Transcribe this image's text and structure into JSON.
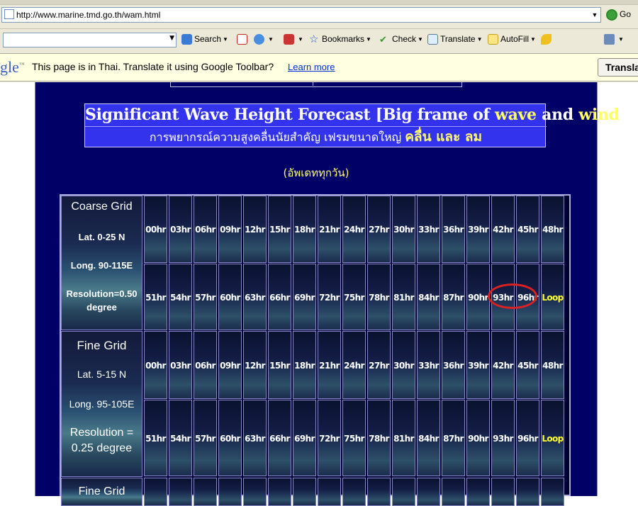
{
  "browser": {
    "url": "http://www.marine.tmd.go.th/wam.html",
    "go_label": "Go",
    "toolbar": {
      "search_label": "Search",
      "bookmarks_label": "Bookmarks",
      "check_label": "Check",
      "translate_label": "Translate",
      "autofill_label": "AutoFill"
    },
    "translate_bar": {
      "logo": "gle",
      "message": "This page is in Thai.  Translate it using Google Toolbar?",
      "link": "Learn more",
      "button": "Transla"
    }
  },
  "page": {
    "title_parts": [
      "Significant Wave Height Forecast [Big frame of ",
      "wave",
      " and ",
      "wind",
      "]"
    ],
    "subtitle_parts": [
      "การพยากรณ์ความสูงคลื่นนัยสำคัญ เฟรมขนาดใหญ่ ",
      "คลื่น และ ลม"
    ],
    "update_note": "(อัพเดททุกวัน)",
    "grids": [
      {
        "name": "Coarse Grid",
        "lat": "Lat. 0-25 N",
        "long": "Long. 90-115E",
        "resolution_lines": [
          "Resolution=0.50",
          "degree"
        ],
        "row1": [
          "00hr",
          "03hr",
          "06hr",
          "09hr",
          "12hr",
          "15hr",
          "18hr",
          "21hr",
          "24hr",
          "27hr",
          "30hr",
          "33hr",
          "36hr",
          "39hr",
          "42hr",
          "45hr",
          "48hr"
        ],
        "row2": [
          "51hr",
          "54hr",
          "57hr",
          "60hr",
          "63hr",
          "66hr",
          "69hr",
          "72hr",
          "75hr",
          "78hr",
          "81hr",
          "84hr",
          "87hr",
          "90hr",
          "93hr",
          "96hr",
          "Loop"
        ]
      },
      {
        "name": "Fine Grid",
        "lat": "Lat. 5-15 N",
        "long": "Long. 95-105E",
        "resolution_lines": [
          "Resolution =",
          "0.25 degree"
        ],
        "row1": [
          "00hr",
          "03hr",
          "06hr",
          "09hr",
          "12hr",
          "15hr",
          "18hr",
          "21hr",
          "24hr",
          "27hr",
          "30hr",
          "33hr",
          "36hr",
          "39hr",
          "42hr",
          "45hr",
          "48hr"
        ],
        "row2": [
          "51hr",
          "54hr",
          "57hr",
          "60hr",
          "63hr",
          "66hr",
          "69hr",
          "72hr",
          "75hr",
          "78hr",
          "81hr",
          "84hr",
          "87hr",
          "90hr",
          "93hr",
          "96hr",
          "Loop"
        ]
      },
      {
        "name": "Fine Grid"
      }
    ]
  },
  "colors": {
    "page_bg": "#000066",
    "title_bg": "#3333ee",
    "highlight": "#ffff66",
    "annotation_ring": "#dd2020"
  }
}
